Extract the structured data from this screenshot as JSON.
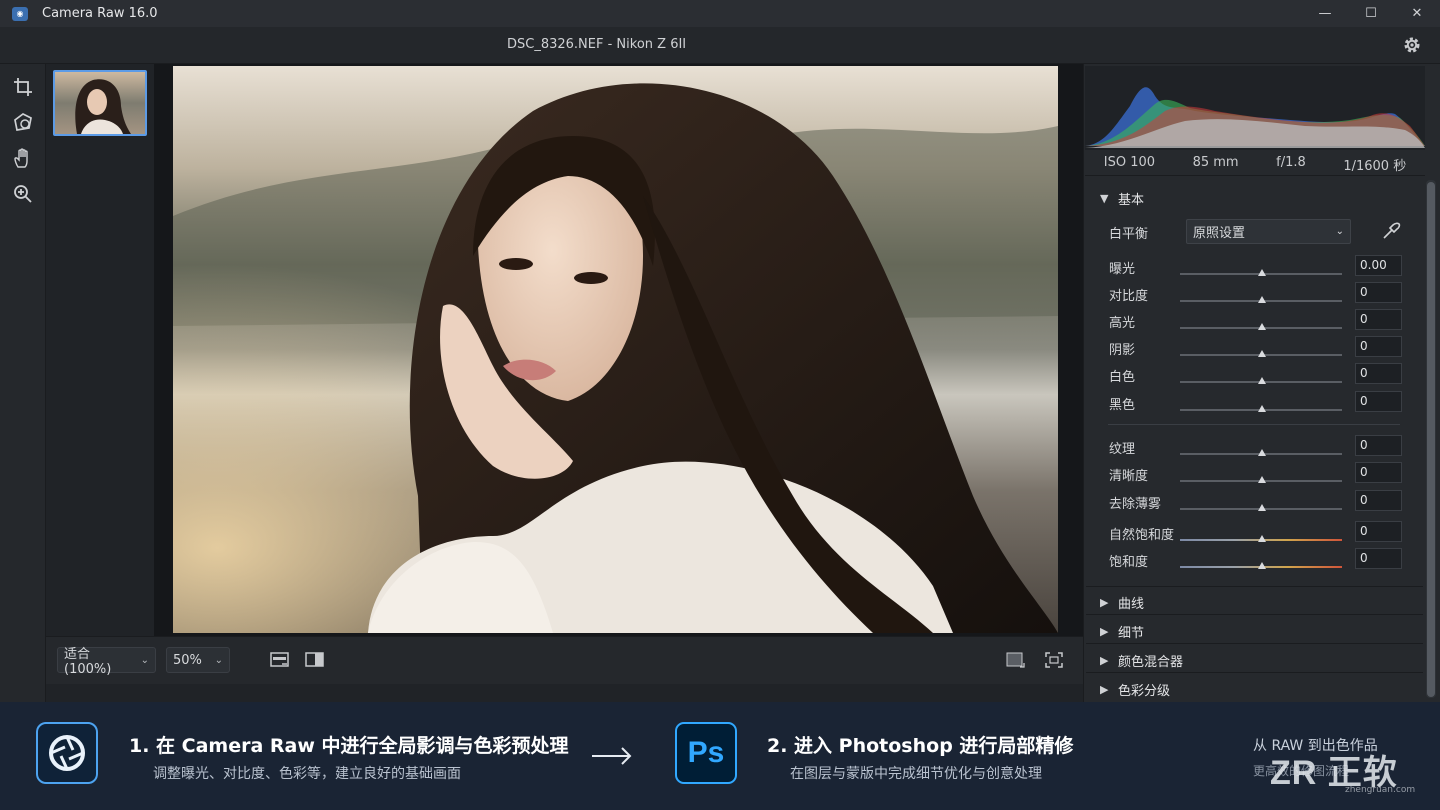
{
  "window": {
    "app_title": "Camera Raw 16.0",
    "minimize": "—",
    "maximize": "☐",
    "close": "✕"
  },
  "header": {
    "file_info": "DSC_8326.NEF  -  Nikon Z 6II"
  },
  "viewbar": {
    "fit_label": "适合 (100%)",
    "zoom_label": "50%"
  },
  "exif": {
    "iso": "ISO 100",
    "focal": "85 mm",
    "aperture": "f/1.8",
    "shutter": "1/1600 秒"
  },
  "panel": {
    "basic_title": "基本",
    "wb_label": "白平衡",
    "wb_value": "原照设置",
    "sliders_group1": [
      {
        "label": "曝光",
        "value": "0.00"
      },
      {
        "label": "对比度",
        "value": "0"
      },
      {
        "label": "高光",
        "value": "0"
      },
      {
        "label": "阴影",
        "value": "0"
      },
      {
        "label": "白色",
        "value": "0"
      },
      {
        "label": "黑色",
        "value": "0"
      }
    ],
    "sliders_group2": [
      {
        "label": "纹理",
        "value": "0"
      },
      {
        "label": "清晰度",
        "value": "0"
      },
      {
        "label": "去除薄雾",
        "value": "0"
      }
    ],
    "sliders_group3": [
      {
        "label": "自然饱和度",
        "value": "0"
      },
      {
        "label": "饱和度",
        "value": "0"
      }
    ],
    "collapsed_sections": [
      "曲线",
      "细节",
      "颜色混合器",
      "色彩分级"
    ]
  },
  "footer": {
    "step1_title": "1. 在 Camera Raw 中进行全局影调与色彩预处理",
    "step1_sub": "调整曝光、对比度、色彩等，建立良好的基础画面",
    "step2_title": "2. 进入 Photoshop 进行局部精修",
    "step2_sub": "在图层与蒙版中完成细节优化与创意处理",
    "ps_icon_text": "Ps",
    "right_line1": "从 RAW 到出色作品",
    "right_line2": "更高效的修图流程",
    "watermark_text": "ZR 正软",
    "watermark_url": "zhengruan.com"
  },
  "colors": {
    "accent": "#5c9be6",
    "ps_blue": "#31a8ff",
    "ps_bg": "#001e36"
  }
}
